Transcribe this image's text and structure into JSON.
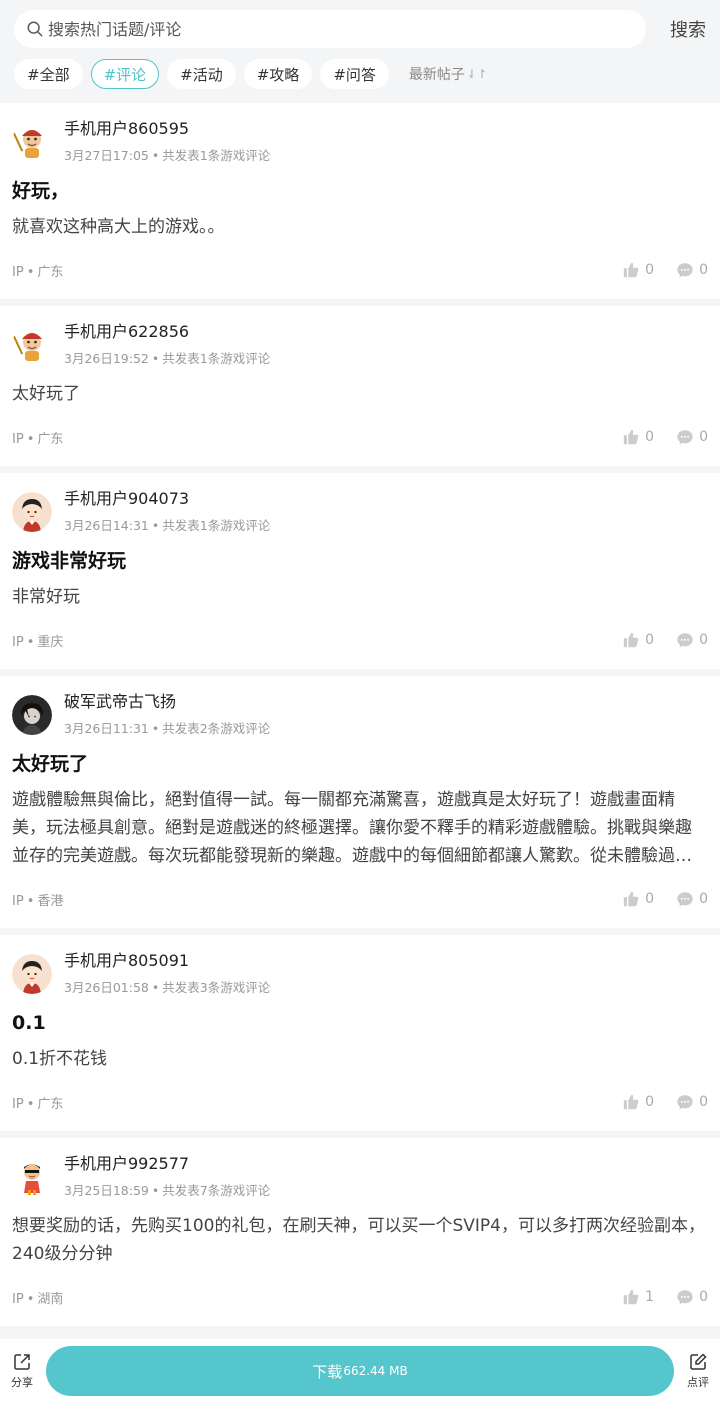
{
  "search": {
    "placeholder": "搜索热门话题/评论",
    "button_label": "搜索"
  },
  "tags": [
    {
      "label": "#全部",
      "active": false
    },
    {
      "label": "#评论",
      "active": true
    },
    {
      "label": "#活动",
      "active": false
    },
    {
      "label": "#攻略",
      "active": false
    },
    {
      "label": "#问答",
      "active": false
    }
  ],
  "sort": {
    "label": "最新帖子",
    "arrows": "⇃↾"
  },
  "posts": [
    {
      "avatar": "monkey-king-avatar",
      "username": "手机用户860595",
      "date": "3月27日17:05",
      "dot": "•",
      "meta": "共发表1条游戏评论",
      "title": "好玩，",
      "body": "就喜欢这种高大上的游戏。。",
      "ip_label": "IP",
      "ip_region": "广东",
      "likes": "0",
      "comments": "0"
    },
    {
      "avatar": "monkey-king-avatar",
      "username": "手机用户622856",
      "date": "3月26日19:52",
      "dot": "•",
      "meta": "共发表1条游戏评论",
      "title": "",
      "body": "太好玩了",
      "ip_label": "IP",
      "ip_region": "广东",
      "likes": "0",
      "comments": "0"
    },
    {
      "avatar": "boy-avatar",
      "username": "手机用户904073",
      "date": "3月26日14:31",
      "dot": "•",
      "meta": "共发表1条游戏评论",
      "title": "游戏非常好玩",
      "body": "非常好玩",
      "ip_label": "IP",
      "ip_region": "重庆",
      "likes": "0",
      "comments": "0"
    },
    {
      "avatar": "anime-avatar",
      "username": "破军武帝古飞扬",
      "date": "3月26日11:31",
      "dot": "•",
      "meta": "共发表2条游戏评论",
      "title": "太好玩了",
      "body": "遊戲體驗無與倫比，絕對值得一試。每一關都充滿驚喜，遊戲真是太好玩了！遊戲畫面精美，玩法極具創意。絕對是遊戲迷的終極選擇。讓你愛不釋手的精彩遊戲體驗。挑戰與樂趣並存的完美遊戲。每次玩都能發現新的樂趣。遊戲中的每個細節都讓人驚歎。從未體驗過如此精彩的遊戲。",
      "ip_label": "IP",
      "ip_region": "香港",
      "likes": "0",
      "comments": "0"
    },
    {
      "avatar": "boy-avatar",
      "username": "手机用户805091",
      "date": "3月26日01:58",
      "dot": "•",
      "meta": "共发表3条游戏评论",
      "title": "0.1",
      "body": "0.1折不花钱",
      "ip_label": "IP",
      "ip_region": "广东",
      "likes": "0",
      "comments": "0"
    },
    {
      "avatar": "cartoon-kid-avatar",
      "username": "手机用户992577",
      "date": "3月25日18:59",
      "dot": "•",
      "meta": "共发表7条游戏评论",
      "title": "",
      "body": "想要奖励的话，先购买100的礼包，在刷天神，可以买一个SVIP4，可以多打两次经验副本，240级分分钟",
      "ip_label": "IP",
      "ip_region": "湖南",
      "likes": "1",
      "comments": "0"
    }
  ],
  "bottom": {
    "share_label": "分享",
    "download_label": "下载",
    "download_size": "662.44 MB",
    "review_label": "点评"
  },
  "colors": {
    "accent": "#55c6cc",
    "tag_active": "#4fc3c9"
  }
}
